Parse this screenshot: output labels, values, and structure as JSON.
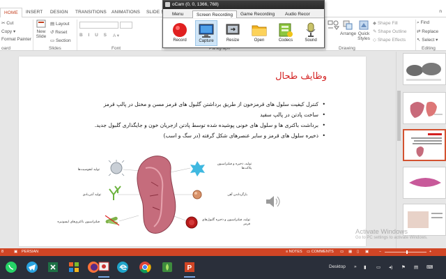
{
  "ribbon": {
    "tabs": [
      "HOME",
      "INSERT",
      "DESIGN",
      "TRANSITIONS",
      "ANIMATIONS",
      "SLIDE S"
    ],
    "sign_in": "n",
    "clipboard": {
      "cut": "Cut",
      "copy": "Copy",
      "format_painter": "Format Painter",
      "group": "oard"
    },
    "slides": {
      "new_slide": "New",
      "new_slide2": "Slide",
      "layout": "Layout",
      "reset": "Reset",
      "section": "Section",
      "group": "Slides"
    },
    "font": {
      "group": "Font"
    },
    "paragraph": {
      "group": "Paragraph"
    },
    "drawing": {
      "arrange": "Arrange",
      "quick_styles": "Quick",
      "quick_styles2": "Styles",
      "shape_fill": "Shape Fill",
      "shape_outline": "Shape Outline",
      "shape_effects": "Shape Effects",
      "group": "Drawing"
    },
    "editing": {
      "find": "Find",
      "replace": "Replace",
      "select": "Select",
      "group": "Editing"
    }
  },
  "ocam": {
    "title": "oCam (0, 0, 1366, 768)",
    "menu_tabs": [
      "Menu",
      "Screen Recording",
      "Game Recording",
      "Audio Recor"
    ],
    "buttons": [
      "Record",
      "Capture",
      "Resize",
      "Open",
      "Codecs",
      "Sound"
    ]
  },
  "slide": {
    "title": "وظایف طحال",
    "bullets": [
      "کنترل کیفیت سلول های قرمزخون از طریق برداشتن گلبول های  قرمز مسن و مختل در پالپ قرمز",
      "ساخت پادتن در پالپ سفید",
      "برداشت باکتری ها و سلول های خونی پوشیده شده توسط پادتن ازجریان خون و جایگذاری گلبول جدید.",
      "ذخیره سلول های قرمز و سایر عنصرهای شکل گرفته (در سگ و اسب)"
    ],
    "diagram_labels": {
      "lymphocytes": "تولید لنفوسیت‌ها",
      "antibody": "تولید آنتی‌بادی",
      "opsonized": "فیلتراسیون باکتری‌های اپسونیزه",
      "top_right": "تولید، ذخیره و فیلتراسیون پلاکت‌ها",
      "iron": "بازگرداندن آهن",
      "rbc": "تولید، فیلتراسیون و ذخیره گلبول‌های قرمز"
    }
  },
  "activate": {
    "title": "Activate Windows",
    "subtitle": "Go to PC settings to activate Windows."
  },
  "status": {
    "slide": "8",
    "language": "PERSIAN",
    "notes": "NOTES",
    "comments": "COMMENTS"
  },
  "taskbar": {
    "desktop": "Desktop"
  },
  "colors": {
    "accent": "#d04525",
    "title_red": "#d32020",
    "taskbar": "#2a2f3a"
  }
}
